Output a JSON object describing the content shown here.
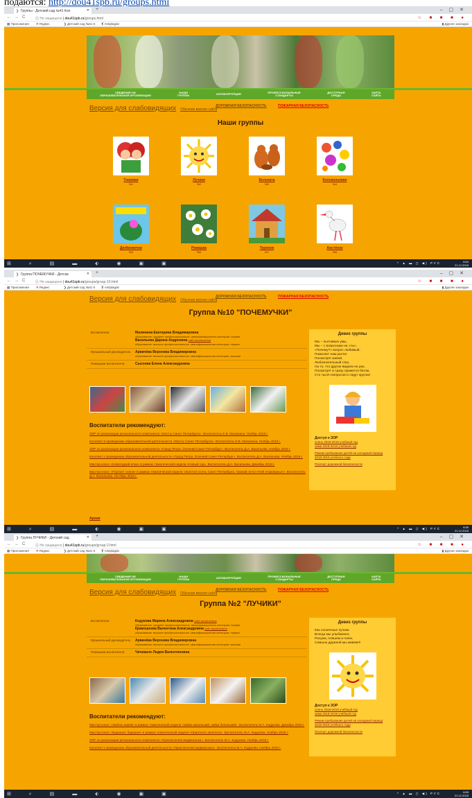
{
  "caption": {
    "prefix": "подаются: ",
    "link": "http://dou41spb.ru/groups.html"
  },
  "browser1": {
    "tab_title": "Группы - Детский сад №41 Кол",
    "new_tab": "+",
    "url_secure": "Не защищено",
    "url_host": "dou41spb.ru",
    "url_path": "/groups.html",
    "bm_apps": "Приложения",
    "bm_yandex": "Яндекс",
    "bm_dou": "Детский сад №41 К",
    "bm_anti": "Antiplagiat",
    "bm_other": "Другие закладки"
  },
  "browser2": {
    "tab_title": "Группа ПОЧЕМУЧКИ - Детски",
    "url_path": "/groups/group-10.html"
  },
  "browser3": {
    "tab_title": "Группа ЛУЧИКИ - Детский сад",
    "url_path": "/groups/group-2.html"
  },
  "site": {
    "menu": [
      "СВЕДЕНИЯ ОБ\nОБРАЗОВАТЕЛЬНОЙ ОРГАНИЗАЦИИ",
      "НАШИ\nГРУППЫ",
      "АНТИКОРРУПЦИЯ",
      "ПРОФЕССИОНАЛЬНЫЕ\nСТАНДАРТЫ",
      "ДОСТУПНАЯ\nСРЕДА",
      "КАРТА\nСАЙТА"
    ],
    "vision_big": "Версия для слабовидящих",
    "vision_small": "Обычная версия сайта",
    "road_safety": "ДОРОЖНАЯ БЕЗОПАСНОСТЬ",
    "fire_safety": "ПОЖАРНАЯ БЕЗОПАСНОСТЬ"
  },
  "groups_page": {
    "title": "Наши группы",
    "groups": [
      {
        "name": "Гномики",
        "num": "№1"
      },
      {
        "name": "Лучики",
        "num": "№2"
      },
      {
        "name": "Бельчата",
        "num": "№3"
      },
      {
        "name": "Колокольчики",
        "num": "№4"
      },
      {
        "name": "Дюймовочки",
        "num": "№5"
      },
      {
        "name": "Ромашка",
        "num": "№6"
      },
      {
        "name": "Теремок",
        "num": "№7"
      },
      {
        "name": "Аистёнок",
        "num": "№8"
      }
    ]
  },
  "group10": {
    "title": "Группа №10 \"ПОЧЕМУЧКИ\"",
    "rows": [
      {
        "label": "Воспитатели:",
        "lines": [
          {
            "name": "Малинина Екатерина Владимировна",
            "link": "",
            "info": "образование: среднее профессиональное, квалификационная категория: первая"
          },
          {
            "name": "Васильева Дарина Андреевна",
            "link": "сайт воспитателя",
            "info": "образование: высшее профессиональное, квалификационная категория: первая"
          }
        ]
      },
      {
        "label": "Музыкальный руководитель:",
        "lines": [
          {
            "name": "Арвачёва Вероника Владимировна",
            "link": "",
            "info": "образование: высшее профессиональное, квалификационная категория: высшая"
          }
        ]
      },
      {
        "label": "Помощник воспитателя:",
        "lines": [
          {
            "name": "Сысоева Елена Александровна",
            "link": "",
            "info": ""
          }
        ]
      }
    ],
    "rec_title": "Воспитатели рекомендуют:",
    "recs": [
      "ЗОР по реализации регионального компонента «Мосты Санкт-Петербурга». Воспитатель Е.В. Малинина. Ноябрь 2018 г.",
      "Конспект в проведению образовательной деятельности «Мосты Санкт-Петербурга». Воспитатель Е.В. Малинина. Ноябрь 2018 г.",
      "ЗОР по реализации регионального компонента «Город Петра. Осенний Санкт-Петербург». Воспитатель Д.А. Васильева. Ноябрь 2018 г.",
      "Конспект к проведению образовательной деятельности «Город Петра. Осенний Санкт-Петербург». Воспитатель Д.А. Васильева. Ноябрь 2018 г.",
      "Мастер-класс «Новогодний ёлка» в рамках тематической недели «Новый год». Воспитатель Д.А. Васильева. Декабрь 2018 г.",
      "Мастер-класс «Портрет осени» в рамках тематической недели «Золотая осень Санкт-Петербурга. Урожай лета! Очей очарованье!». Воспитатель Д.А. Васильева. Октябрь 2018 г."
    ],
    "archive": "Архив",
    "motto_title": "Девиз группы",
    "motto": "Мы – пытливые умы,\nМы – с вопросами на «ты»,\n«Почему?» вопрос любимый,\nПомогает нам расти!\nПосмотрят живой,\nЛюбознательный глаз,\nНа то, что другие видали не раз,\nПосмотрят и сразу примется бегом,\nСто тысяч вопросов и сядут кругом!",
    "zor_title": "Доступ к ЗОР",
    "zor_links": [
      "осень 2018-2019 учебный год",
      "зима 2018-2019 учебный год"
    ],
    "cold_link": "Режим пребывания детей на холодный период 2018-2019 учебного года",
    "road_link": "Паспорт дорожной безопасности"
  },
  "group2": {
    "title": "Группа №2 \"ЛУЧИКИ\"",
    "rows": [
      {
        "label": "Воспитатели:",
        "lines": [
          {
            "name": "Кодукова Марина Александровна",
            "link": "сайт воспитателя",
            "info": "образование: среднее профессиональное, квалификационная категория: первая"
          },
          {
            "name": "Кривошеева Валентина Александровна",
            "link": "сайт воспитателя",
            "info": "образование: высшее профессиональное, квалификационная категория: первая"
          }
        ]
      },
      {
        "label": "Музыкальный руководитель:",
        "lines": [
          {
            "name": "Арвачёва Вероника Владимировна",
            "link": "",
            "info": "образование: высшее профессиональное, квалификационная категория: высшая"
          }
        ]
      },
      {
        "label": "Помощник воспитателя:",
        "lines": [
          {
            "name": "Чичикало Лидия Валентиновна",
            "link": "",
            "info": ""
          }
        ]
      }
    ],
    "rec_title": "Воспитатели рекомендуют:",
    "recs": [
      "Мастер-класс «Зайчик зимой» в рамках тематической недели «Зайка маленький, зайка беленький». Воспитатель М.А. Кодукова. Декабрь 2018 г.",
      "Мастер-класс «Барашек, барашек» в рамках тематической недели «Приятного аппетита». Воспитатель М.А. Кодукова. Ноябрь 2018 г.",
      "ЗОР по реализации регионального компонента «Приключения медвежонка». Воспитатель М.А. Кодукова. Ноябрь 2018 г.",
      "Конспект к проведению образовательной деятельности «Приключения медвежонка». Воспитатель М.А. Кодукова. Ноябрь 2018 г."
    ],
    "motto_title": "Девиз группы",
    "motto": "Как солнечные лучики\nВсегда мы улыбаемся,\nРисуем, пляшем и поем,\nСемьею дружной мы живем!!!",
    "zor_title": "Доступ к ЗОР",
    "zor_links": [
      "осень 2018-2019 учебный год",
      "зима 2018-2019 учебный год"
    ],
    "cold_link": "Режим пребывания детей на холодный период 2018-2019 учебного года",
    "road_link": "Паспорт дорожной безопасности"
  },
  "taskbar": {
    "lang": "РУС",
    "times": [
      "6:54",
      "6:55",
      "6:55"
    ],
    "date": "21.12.2018"
  },
  "colors": {
    "page_bg": "#f6a500",
    "menu_green": "#5fa728",
    "link": "#8b1a00",
    "fire": "#dd0000",
    "side_bg": "#ffcc33"
  }
}
